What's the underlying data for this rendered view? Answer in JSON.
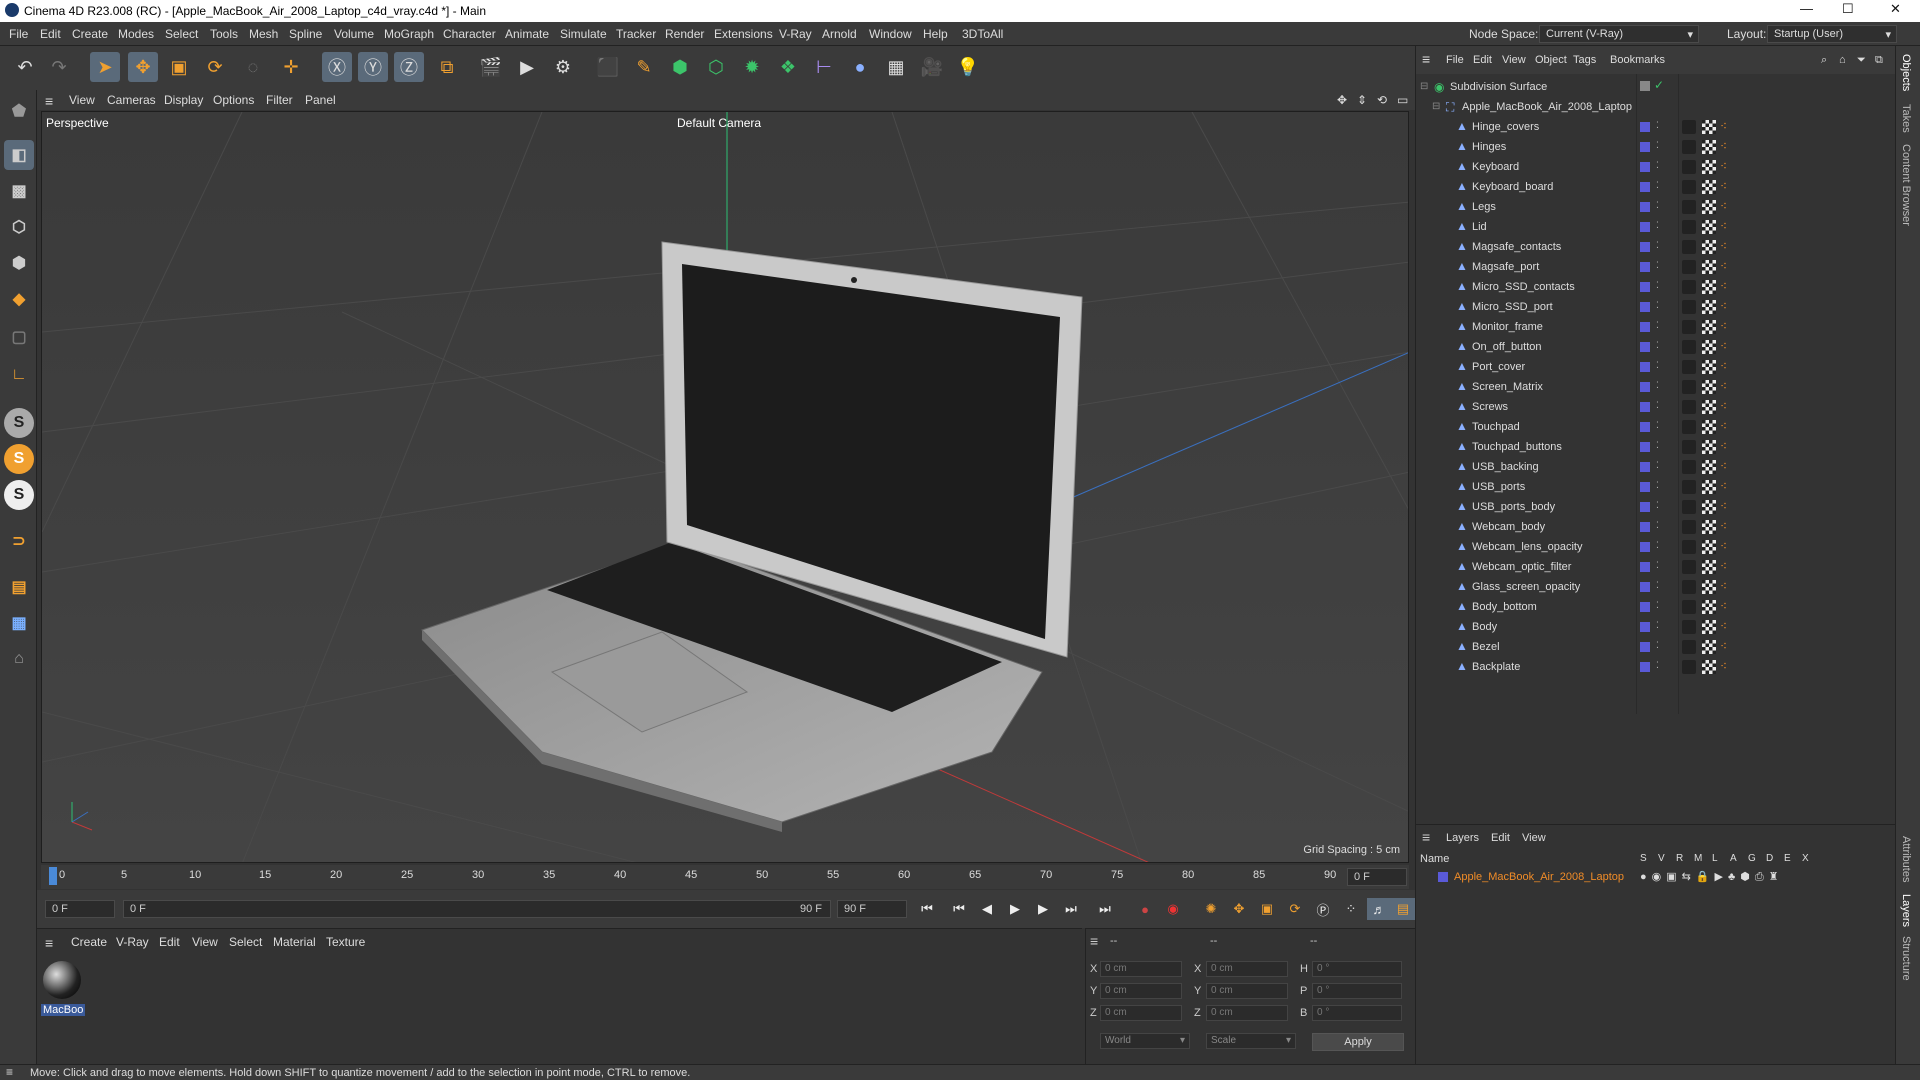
{
  "window": {
    "title": "Cinema 4D R23.008 (RC) - [Apple_MacBook_Air_2008_Laptop_c4d_vray.c4d *] - Main",
    "minimize": "—",
    "maximize": "☐",
    "close": "✕"
  },
  "menubar": {
    "items": [
      "File",
      "Edit",
      "Create",
      "Modes",
      "Select",
      "Tools",
      "Mesh",
      "Spline",
      "Volume",
      "MoGraph",
      "Character",
      "Animate",
      "Simulate",
      "Tracker",
      "Render",
      "Extensions",
      "V-Ray",
      "Arnold",
      "Window",
      "Help",
      "3DToAll"
    ],
    "node_space_label": "Node Space:",
    "node_space_value": "Current (V-Ray)",
    "layout_label": "Layout:",
    "layout_value": "Startup (User)"
  },
  "viewport": {
    "menu": [
      "View",
      "Cameras",
      "Display",
      "Options",
      "Filter",
      "Panel"
    ],
    "caption": "Perspective",
    "camera": "Default Camera",
    "grid_spacing": "Grid Spacing : 5 cm"
  },
  "timeline": {
    "ticks": [
      "0",
      "5",
      "10",
      "15",
      "20",
      "25",
      "30",
      "35",
      "40",
      "45",
      "50",
      "55",
      "60",
      "65",
      "70",
      "75",
      "80",
      "85",
      "90"
    ],
    "end_field": "0 F"
  },
  "playbar": {
    "start": "0 F",
    "range_start": "0 F",
    "range_end": "90 F",
    "end": "90 F"
  },
  "material": {
    "menu": [
      "Create",
      "V-Ray",
      "Edit",
      "View",
      "Select",
      "Material",
      "Texture"
    ],
    "item_label": "MacBoo"
  },
  "coords": {
    "headers": [
      "--",
      "--",
      "--"
    ],
    "rows": [
      {
        "a": "X",
        "av": "0 cm",
        "b": "X",
        "bv": "0 cm",
        "c": "H",
        "cv": "0 °"
      },
      {
        "a": "Y",
        "av": "0 cm",
        "b": "Y",
        "bv": "0 cm",
        "c": "P",
        "cv": "0 °"
      },
      {
        "a": "Z",
        "av": "0 cm",
        "b": "Z",
        "bv": "0 cm",
        "c": "B",
        "cv": "0 °"
      }
    ],
    "space": "World",
    "mode": "Scale",
    "apply": "Apply"
  },
  "status": "Move: Click and drag to move elements. Hold down SHIFT to quantize movement / add to the selection in point mode, CTRL to remove.",
  "objects": {
    "menu": [
      "File",
      "Edit",
      "View",
      "Object",
      "Tags",
      "Bookmarks"
    ],
    "root": "Subdivision Surface",
    "group": "Apple_MacBook_Air_2008_Laptop",
    "children": [
      "Hinge_covers",
      "Hinges",
      "Keyboard",
      "Keyboard_board",
      "Legs",
      "Lid",
      "Magsafe_contacts",
      "Magsafe_port",
      "Micro_SSD_contacts",
      "Micro_SSD_port",
      "Monitor_frame",
      "On_off_button",
      "Port_cover",
      "Screen_Matrix",
      "Screws",
      "Touchpad",
      "Touchpad_buttons",
      "USB_backing",
      "USB_ports",
      "USB_ports_body",
      "Webcam_body",
      "Webcam_lens_opacity",
      "Webcam_optic_filter",
      "Glass_screen_opacity",
      "Body_bottom",
      "Body",
      "Bezel",
      "Backplate"
    ]
  },
  "layers": {
    "menu": [
      "Layers",
      "Edit",
      "View"
    ],
    "name_header": "Name",
    "cols": [
      "S",
      "V",
      "R",
      "M",
      "L",
      "A",
      "G",
      "D",
      "E",
      "X"
    ],
    "layer_name": "Apple_MacBook_Air_2008_Laptop",
    "accent": "#f08c28"
  },
  "side_tabs": [
    "Objects",
    "Takes",
    "Content Browser",
    "Attributes",
    "Layers",
    "Structure"
  ]
}
